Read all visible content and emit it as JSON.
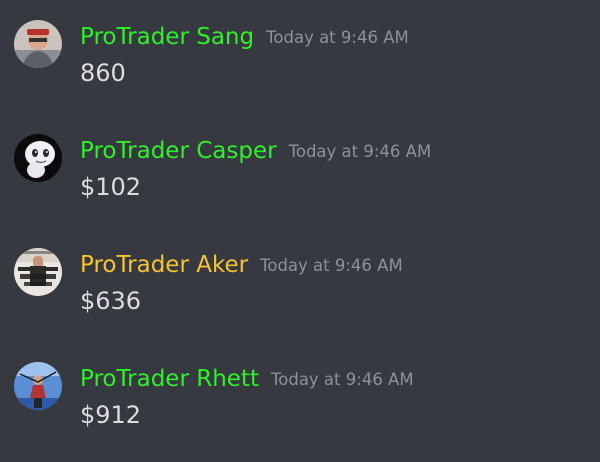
{
  "colors": {
    "background": "#36393f",
    "message_text": "#dcddde",
    "timestamp_text": "#8e9297",
    "green_role": "#2ff02b",
    "gold_role": "#f5c431"
  },
  "messages": [
    {
      "username": "ProTrader Sang",
      "name_color": "#2ff02b",
      "timestamp": "Today at 9:46 AM",
      "content": "860",
      "avatar_icon": "user-photo-sang"
    },
    {
      "username": "ProTrader Casper",
      "name_color": "#2ff02b",
      "timestamp": "Today at 9:46 AM",
      "content": "$102",
      "avatar_icon": "casper-ghost"
    },
    {
      "username": "ProTrader Aker",
      "name_color": "#f5c431",
      "timestamp": "Today at 9:46 AM",
      "content": "$636",
      "avatar_icon": "meme-image"
    },
    {
      "username": "ProTrader Rhett",
      "name_color": "#2ff02b",
      "timestamp": "Today at 9:46 AM",
      "content": "$912",
      "avatar_icon": "user-photo-sky"
    }
  ]
}
